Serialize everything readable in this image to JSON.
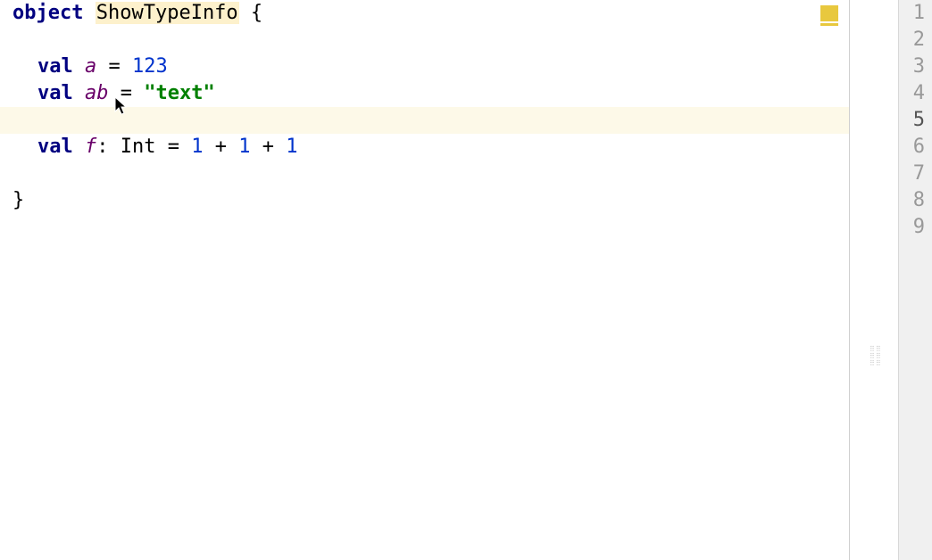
{
  "code": {
    "line1": {
      "keyword": "object",
      "classname": "ShowTypeInfo",
      "brace": " {"
    },
    "line3": {
      "keyword": "val",
      "ident": " a",
      "rest": " = ",
      "num": "123"
    },
    "line4": {
      "keyword": "val",
      "ident": " ab",
      "rest": " = ",
      "str": "\"text\""
    },
    "line6": {
      "keyword": "val",
      "ident": " f",
      "colon": ": ",
      "type": "Int",
      "eq": " = ",
      "n1": "1",
      "p1": " + ",
      "n2": "1",
      "p2": " + ",
      "n3": "1"
    },
    "line8": {
      "brace": "}"
    }
  },
  "gutter": {
    "l1": "1",
    "l2": "2",
    "l3": "3",
    "l4": "4",
    "l5": "5",
    "l6": "6",
    "l7": "7",
    "l8": "8",
    "l9": "9"
  },
  "minimap_dots": "⠿⠿\n⠿⠿\n⠿⠿"
}
